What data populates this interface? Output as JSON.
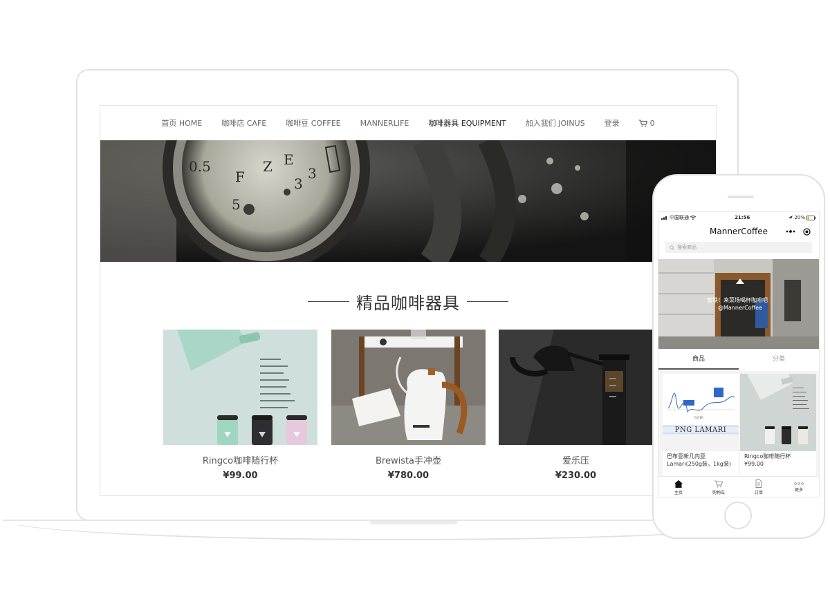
{
  "website": {
    "nav": {
      "items": [
        "首页 HOME",
        "咖啡店 CAFE",
        "咖啡豆 COFFEE",
        "MANNERLIFE",
        "咖啡器具 EQUIPMENT",
        "加入我们 JOINUS",
        "登录"
      ],
      "cart_count": "0"
    },
    "section_title": "精品咖啡器具",
    "products": [
      {
        "name": "Ringco咖啡随行杯",
        "price": "¥99.00"
      },
      {
        "name": "Brewista手冲壶",
        "price": "¥780.00"
      },
      {
        "name": "爱乐压",
        "price": "¥230.00"
      }
    ]
  },
  "miniprogram": {
    "status": {
      "carrier": "中国联通",
      "time": "21:56",
      "battery": "20%"
    },
    "title": "MannerCoffee",
    "search_placeholder": "搜索商品",
    "banner_caption": "管铁！来菜场喝杯咖啡吧",
    "banner_handle": "@MannerCoffee",
    "tabs": [
      "商品",
      "分类"
    ],
    "products": [
      {
        "name": "巴布亚新几内亚Lamari(250g装，1kg装)",
        "price": ""
      },
      {
        "name": "Ringco咖啡随行杯",
        "price": "¥99.00"
      }
    ],
    "card_sign": "PNG LAMARI",
    "card_chart_label": "FILTER",
    "tabbar": [
      "主页",
      "购物车",
      "订单",
      "更多"
    ]
  },
  "colors": {
    "nav_text": "#666666",
    "nav_active": "#222222",
    "title": "#333333"
  }
}
